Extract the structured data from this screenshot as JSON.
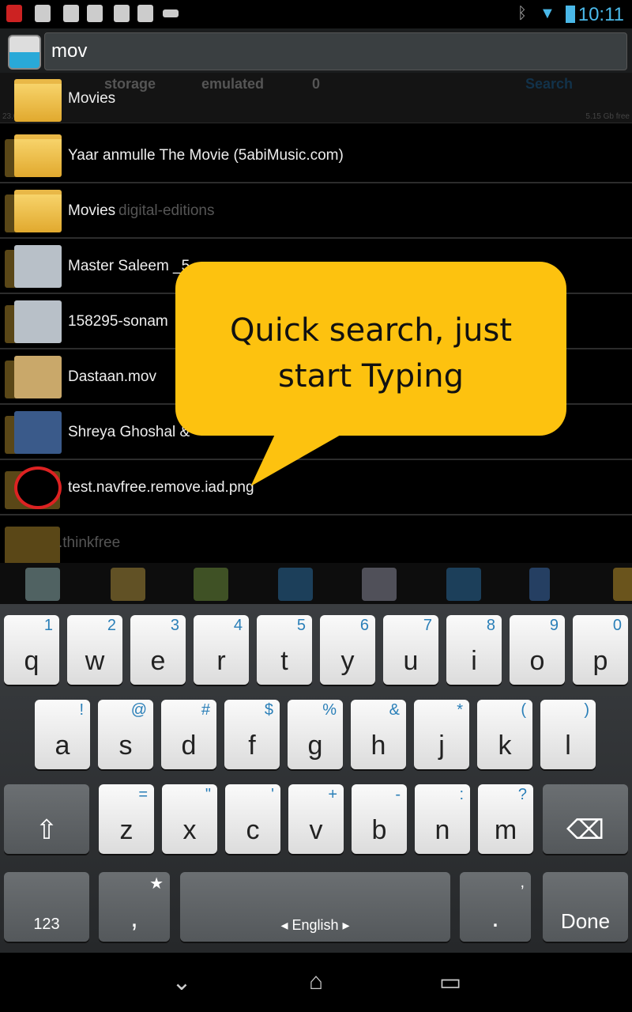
{
  "status_bar": {
    "time": "10:11",
    "left_icons": [
      "app-shield-icon",
      "skype-icon",
      "facebook-icon",
      "gallery-icon",
      "facebook-icon",
      "facebook-icon",
      "keyboard-icon"
    ],
    "right_icons": [
      "bluetooth-off-icon",
      "wifi-icon",
      "battery-charging-icon"
    ]
  },
  "search": {
    "value": "mov"
  },
  "breadcrumb": {
    "items": [
      "storage",
      "emulated",
      "0"
    ],
    "search_label": "Search",
    "used": "23.02 Gb used",
    "free": "5.15 Gb free"
  },
  "results": [
    {
      "name": "Movies",
      "type": "folder",
      "bg": ""
    },
    {
      "name": "Yaar anmulle The Movie (5abiMusic.com)",
      "type": "folder",
      "bg": ""
    },
    {
      "name": "Movies",
      "type": "folder",
      "bg": "digital-editions"
    },
    {
      "name": "Master Saleem _5",
      "type": "image",
      "bg": ""
    },
    {
      "name": "158295-sonam",
      "type": "image",
      "bg": ""
    },
    {
      "name": "Dastaan.mov",
      "type": "unknown",
      "bg": ""
    },
    {
      "name": "Shreya Ghoshal & ",
      "type": "video",
      "bg": ""
    },
    {
      "name": "test.navfree.remove.iad.png",
      "type": "blocked",
      "bg": ""
    },
    {
      "name": "",
      "type": "folder",
      "bg": ".thinkfree"
    }
  ],
  "toolbar": [
    "home-icon",
    "new-folder-icon",
    "multi-select-icon",
    "back-icon",
    "search-icon",
    "refresh-icon",
    "tap-icon",
    "favorite-icon"
  ],
  "tooltip": {
    "line1": "Quick search, just",
    "line2": "start Typing"
  },
  "keyboard": {
    "row1": [
      [
        "q",
        "1"
      ],
      [
        "w",
        "2"
      ],
      [
        "e",
        "3"
      ],
      [
        "r",
        "4"
      ],
      [
        "t",
        "5"
      ],
      [
        "y",
        "6"
      ],
      [
        "u",
        "7"
      ],
      [
        "i",
        "8"
      ],
      [
        "o",
        "9"
      ],
      [
        "p",
        "0"
      ]
    ],
    "row2": [
      [
        "a",
        "!"
      ],
      [
        "s",
        "@"
      ],
      [
        "d",
        "#"
      ],
      [
        "f",
        "$"
      ],
      [
        "g",
        "%"
      ],
      [
        "h",
        "&"
      ],
      [
        "j",
        "*"
      ],
      [
        "k",
        "("
      ],
      [
        "l",
        ")"
      ]
    ],
    "row3": [
      [
        "z",
        "="
      ],
      [
        "x",
        "\""
      ],
      [
        "c",
        "'"
      ],
      [
        "v",
        "+"
      ],
      [
        "b",
        "-"
      ],
      [
        "n",
        ":"
      ],
      [
        "m",
        "?"
      ]
    ],
    "symbols": "123",
    "comma": ",",
    "comma_alt": "★",
    "space": "◂ English ▸",
    "period": ".",
    "period_alt": ",",
    "done": "Done"
  },
  "colors": {
    "tooltip": "#fdc20f",
    "highlight": "#8ad0f0",
    "accent": "#4ab8e8"
  }
}
